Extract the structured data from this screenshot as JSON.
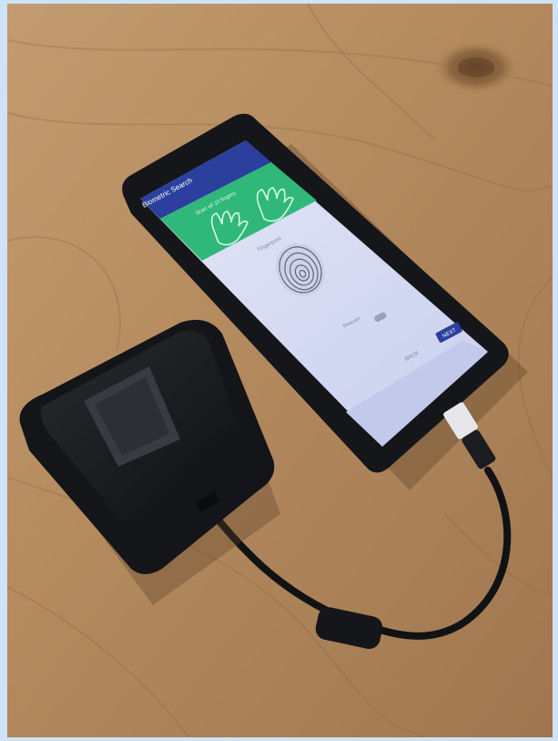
{
  "photo": {
    "subject": "",
    "phone_app": {
      "app_title": "Biometric Search",
      "status_time": "",
      "banner_caption": "Scan all 10 fingers",
      "capture_caption": "Fingerprint",
      "toggle_label": "Rescan",
      "primary_button_label": "NEXT",
      "secondary_label": "BACK"
    },
    "colors": {
      "table_wood": "#b38a5e",
      "phone_body": "#15161a",
      "app_banner": "#2fb87a",
      "app_accent": "#2b3f9c",
      "screen_body": "#d9def4",
      "scanner_body": "#1a1b1f"
    }
  }
}
